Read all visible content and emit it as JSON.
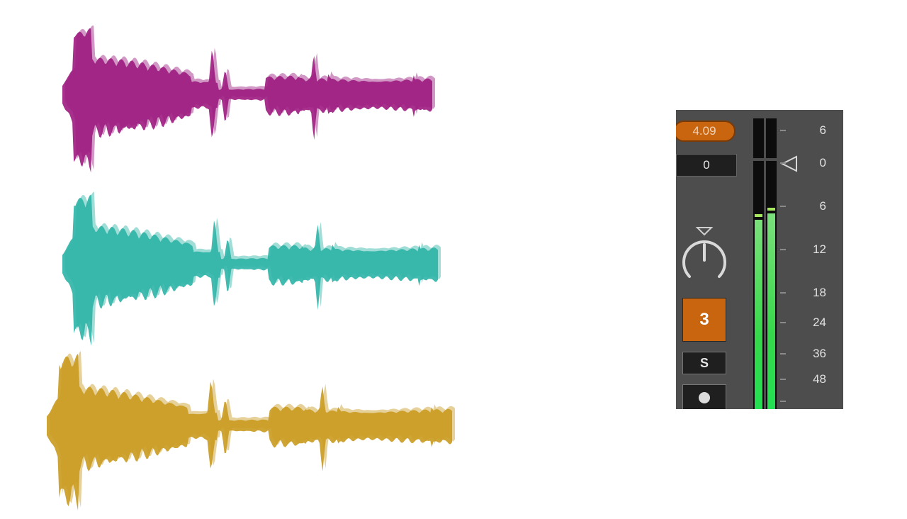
{
  "waveforms": [
    {
      "name": "magenta-waveform",
      "color": "#9c1a7e"
    },
    {
      "name": "teal-waveform",
      "color": "#2cb3a6"
    },
    {
      "name": "gold-waveform",
      "color": "#c99a1e"
    }
  ],
  "mixer": {
    "peak_level": "4.09",
    "volume": "0",
    "track_number": "3",
    "solo_label": "S",
    "accent_color": "#c8650e",
    "meter_left_level": 0.66,
    "meter_right_level": 0.68,
    "scale": [
      "6",
      "0",
      "6",
      "12",
      "18",
      "24",
      "36",
      "48"
    ]
  }
}
